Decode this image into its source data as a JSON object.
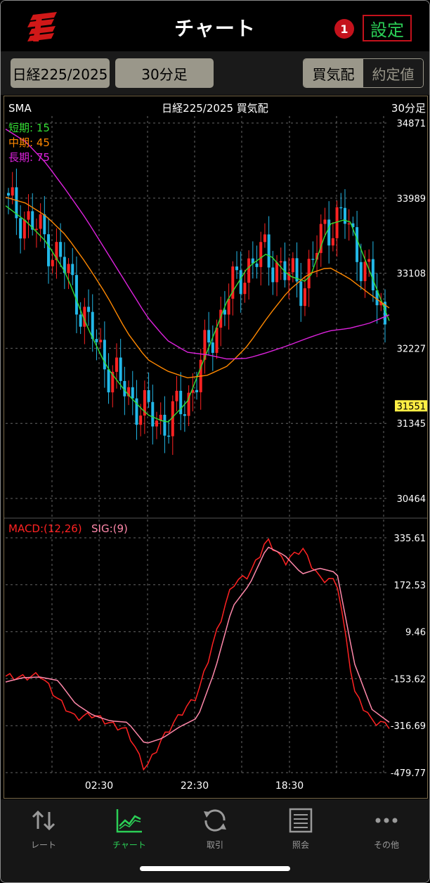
{
  "header": {
    "title": "チャート",
    "badge": "1",
    "settings_label": "設定"
  },
  "toolbar": {
    "symbol_button": "日経225/2025",
    "interval_button": "30分足",
    "segment": {
      "active": "買気配",
      "inactive": "約定値"
    }
  },
  "chart_info": {
    "indicator": "SMA",
    "symbol_title": "日経225/2025  買気配",
    "interval": "30分足",
    "legend": [
      "短期: 15",
      "中期: 45",
      "長期: 75"
    ],
    "macd_label": "MACD:(12,26)",
    "sig_label": "SIG:(9)"
  },
  "colors": {
    "short": "#33dd33",
    "mid": "#ff8800",
    "long": "#dd22dd",
    "up": "#ff2222",
    "down": "#22b8e8",
    "macd": "#ff2222",
    "sig": "#ff88aa",
    "price_tag": "#ffee44",
    "accent": "#2bcf56",
    "badge": "#c4121c"
  },
  "chart_data": [
    {
      "type": "line",
      "series": [
        {
          "name": "短期: 15",
          "values": [
            33900,
            33720,
            33480,
            33100,
            32500,
            32010,
            31700,
            31450,
            31350,
            31600,
            32200,
            32800,
            33180,
            33350,
            33080,
            33000,
            33680,
            33750,
            33150,
            32550
          ]
        },
        {
          "name": "中期: 45",
          "values": [
            34000,
            33930,
            33780,
            33550,
            33220,
            32850,
            32420,
            32100,
            31960,
            31880,
            31910,
            32020,
            32260,
            32600,
            32900,
            33100,
            33180,
            33050,
            32870,
            32700
          ]
        },
        {
          "name": "長期: 75",
          "values": [
            34800,
            34650,
            34400,
            34080,
            33740,
            33360,
            32980,
            32600,
            32320,
            32180,
            32150,
            32100,
            32110,
            32180,
            32260,
            32350,
            32430,
            32460,
            32520,
            32620
          ]
        }
      ],
      "current_price": "31551",
      "y_ticks": [
        "34871",
        "33989",
        "33108",
        "32227",
        "31345",
        "30464"
      ],
      "ylim": [
        30464,
        34871
      ]
    },
    {
      "type": "line",
      "series": [
        {
          "name": "MACD:(12,26)",
          "values": [
            -145,
            -150,
            -140,
            -225,
            -290,
            -278,
            -310,
            -335,
            -470,
            -360,
            -278,
            -210,
            -10,
            175,
            210,
            330,
            250,
            300,
            195,
            185,
            -200,
            -300,
            -315
          ]
        },
        {
          "name": "SIG:(9)",
          "values": [
            -165,
            -150,
            -148,
            -160,
            -240,
            -280,
            -300,
            -305,
            -380,
            -360,
            -320,
            -290,
            -125,
            95,
            175,
            305,
            275,
            210,
            230,
            215,
            -100,
            -260,
            -305
          ]
        }
      ],
      "y_ticks": [
        "335.61",
        "172.53",
        "9.46",
        "-153.62",
        "-316.69",
        "-479.77"
      ],
      "ylim": [
        -479.77,
        335.61
      ]
    }
  ],
  "x_ticks": [
    "02:30",
    "22:30",
    "18:30"
  ],
  "nav": [
    {
      "label": "レート",
      "icon": "arrows-updown-icon"
    },
    {
      "label": "チャート",
      "icon": "chart-icon"
    },
    {
      "label": "取引",
      "icon": "refresh-icon"
    },
    {
      "label": "照会",
      "icon": "list-icon"
    },
    {
      "label": "その他",
      "icon": "more-icon"
    }
  ]
}
